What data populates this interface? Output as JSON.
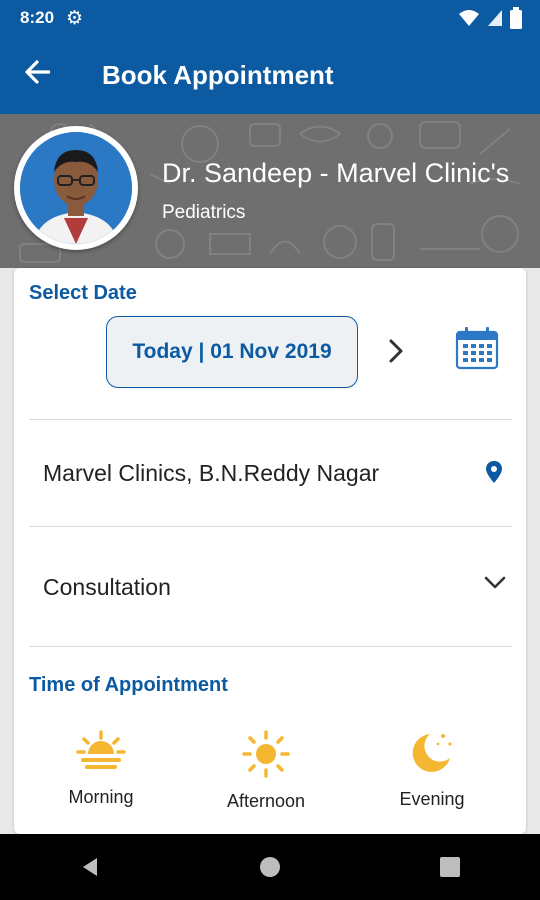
{
  "status_bar": {
    "time": "8:20",
    "icons": [
      "gear-icon",
      "wifi-icon",
      "signal-icon",
      "battery-icon"
    ]
  },
  "app_bar": {
    "title": "Book Appointment",
    "back_icon": "arrow-back-icon"
  },
  "doctor": {
    "name": "Dr. Sandeep - Marvel Clinic's",
    "specialty": "Pediatrics"
  },
  "booking": {
    "select_date_label": "Select Date",
    "date_value": "Today | 01 Nov 2019",
    "clinic": "Marvel Clinics, B.N.Reddy Nagar",
    "type": "Consultation",
    "time_label": "Time of Appointment",
    "slots": [
      {
        "label": "Morning",
        "icon": "sunrise-icon"
      },
      {
        "label": "Afternoon",
        "icon": "sun-icon"
      },
      {
        "label": "Evening",
        "icon": "moon-icon"
      }
    ]
  },
  "colors": {
    "primary": "#0c5aa2",
    "slot_icon": "#f5b731",
    "hero_bg": "#6f6f6f"
  }
}
